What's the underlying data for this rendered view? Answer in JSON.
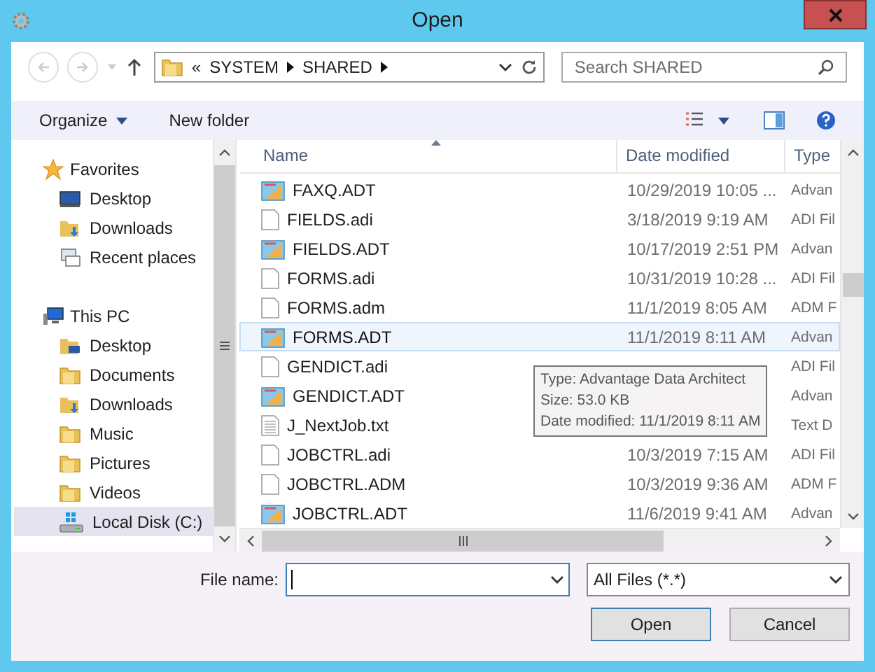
{
  "window": {
    "title": "Open"
  },
  "address": {
    "overflow": "«",
    "crumbs": [
      "SYSTEM",
      "SHARED"
    ]
  },
  "search": {
    "placeholder": "Search SHARED"
  },
  "toolbar": [
    "Organize",
    "New folder"
  ],
  "sidebar": [
    {
      "label": "Favorites",
      "kind": "star",
      "children": [
        {
          "label": "Desktop",
          "kind": "desktop",
          "selected": false
        },
        {
          "label": "Downloads",
          "kind": "downloads",
          "selected": false
        },
        {
          "label": "Recent places",
          "kind": "recent",
          "selected": false
        }
      ]
    },
    {
      "label": "This PC",
      "kind": "pc",
      "children": [
        {
          "label": "Desktop",
          "kind": "desktop-folder",
          "selected": false
        },
        {
          "label": "Documents",
          "kind": "folder",
          "selected": false
        },
        {
          "label": "Downloads",
          "kind": "downloads",
          "selected": false
        },
        {
          "label": "Music",
          "kind": "folder",
          "selected": false
        },
        {
          "label": "Pictures",
          "kind": "folder",
          "selected": false
        },
        {
          "label": "Videos",
          "kind": "folder",
          "selected": false
        },
        {
          "label": "Local Disk (C:)",
          "kind": "disk",
          "selected": true
        }
      ]
    }
  ],
  "table": {
    "columns": [
      "Name",
      "Date modified",
      "Type"
    ],
    "rows": [
      {
        "name": "FAXQ.ADT",
        "date": "10/29/2019 10:05 ...",
        "type": "Advan",
        "kind": "table",
        "selected": false
      },
      {
        "name": "FIELDS.adi",
        "date": "3/18/2019 9:19 AM",
        "type": "ADI Fil",
        "kind": "blank",
        "selected": false
      },
      {
        "name": "FIELDS.ADT",
        "date": "10/17/2019 2:51 PM",
        "type": "Advan",
        "kind": "table",
        "selected": false
      },
      {
        "name": "FORMS.adi",
        "date": "10/31/2019 10:28 ...",
        "type": "ADI Fil",
        "kind": "blank",
        "selected": false
      },
      {
        "name": "FORMS.adm",
        "date": "11/1/2019 8:05 AM",
        "type": "ADM F",
        "kind": "blank",
        "selected": false
      },
      {
        "name": "FORMS.ADT",
        "date": "11/1/2019 8:11 AM",
        "type": "Advan",
        "kind": "table",
        "selected": true
      },
      {
        "name": "GENDICT.adi",
        "type": "ADI Fil",
        "kind": "blank",
        "selected": false
      },
      {
        "name": "GENDICT.ADT",
        "type": "Advan",
        "kind": "table",
        "selected": false
      },
      {
        "name": "J_NextJob.txt",
        "type": "Text D",
        "kind": "text",
        "selected": false
      },
      {
        "name": "JOBCTRL.adi",
        "date": "10/3/2019 7:15 AM",
        "type": "ADI Fil",
        "kind": "blank",
        "selected": false
      },
      {
        "name": "JOBCTRL.ADM",
        "date": "10/3/2019 9:36 AM",
        "type": "ADM F",
        "kind": "blank",
        "selected": false
      },
      {
        "name": "JOBCTRL.ADT",
        "date": "11/6/2019 9:41 AM",
        "type": "Advan",
        "kind": "table",
        "selected": false
      }
    ]
  },
  "tooltip": [
    "Type: Advantage Data Architect",
    "Size: 53.0 KB",
    "Date modified: 11/1/2019 8:11 AM"
  ],
  "file_name": {
    "label": "File name:"
  },
  "filter": {
    "value": "All Files (*.*)"
  },
  "buttons": [
    {
      "label": "Open",
      "default": true
    },
    {
      "label": "Cancel",
      "default": false
    }
  ]
}
